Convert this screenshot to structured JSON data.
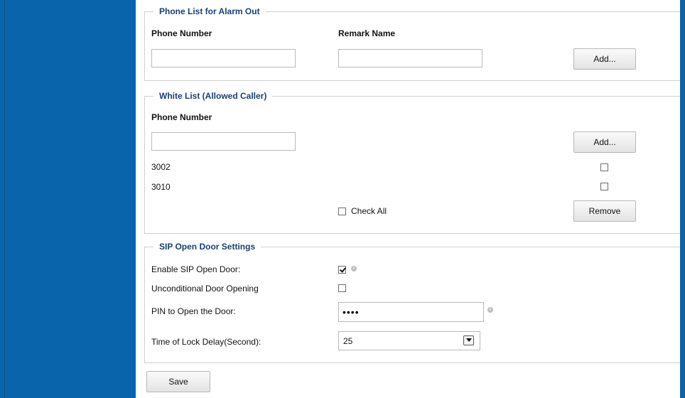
{
  "alarm_out": {
    "legend": "Phone List for Alarm Out",
    "phone_header": "Phone Number",
    "remark_header": "Remark Name",
    "phone_value": "",
    "remark_value": "",
    "add_label": "Add..."
  },
  "white_list": {
    "legend": "White List (Allowed Caller)",
    "phone_header": "Phone Number",
    "phone_value": "",
    "add_label": "Add...",
    "entries": [
      {
        "number": "3002",
        "checked": false
      },
      {
        "number": "3010",
        "checked": false
      }
    ],
    "check_all_label": "Check All",
    "remove_label": "Remove"
  },
  "sip": {
    "legend": "SIP Open Door Settings",
    "enable_label": "Enable SIP Open Door:",
    "enable_checked": true,
    "unconditional_label": "Unconditional Door Opening",
    "unconditional_checked": false,
    "pin_label": "PIN to Open the Door:",
    "pin_value": "••••",
    "lock_delay_label": "Time of Lock Delay(Second):",
    "lock_delay_value": "25"
  },
  "save_label": "Save",
  "icons": {
    "info": "info-icon",
    "dropdown": "chevron-down-icon",
    "check": "checkmark-icon"
  },
  "colors": {
    "sidebar": "#0a64ab",
    "legend_text": "#1b3f73"
  }
}
